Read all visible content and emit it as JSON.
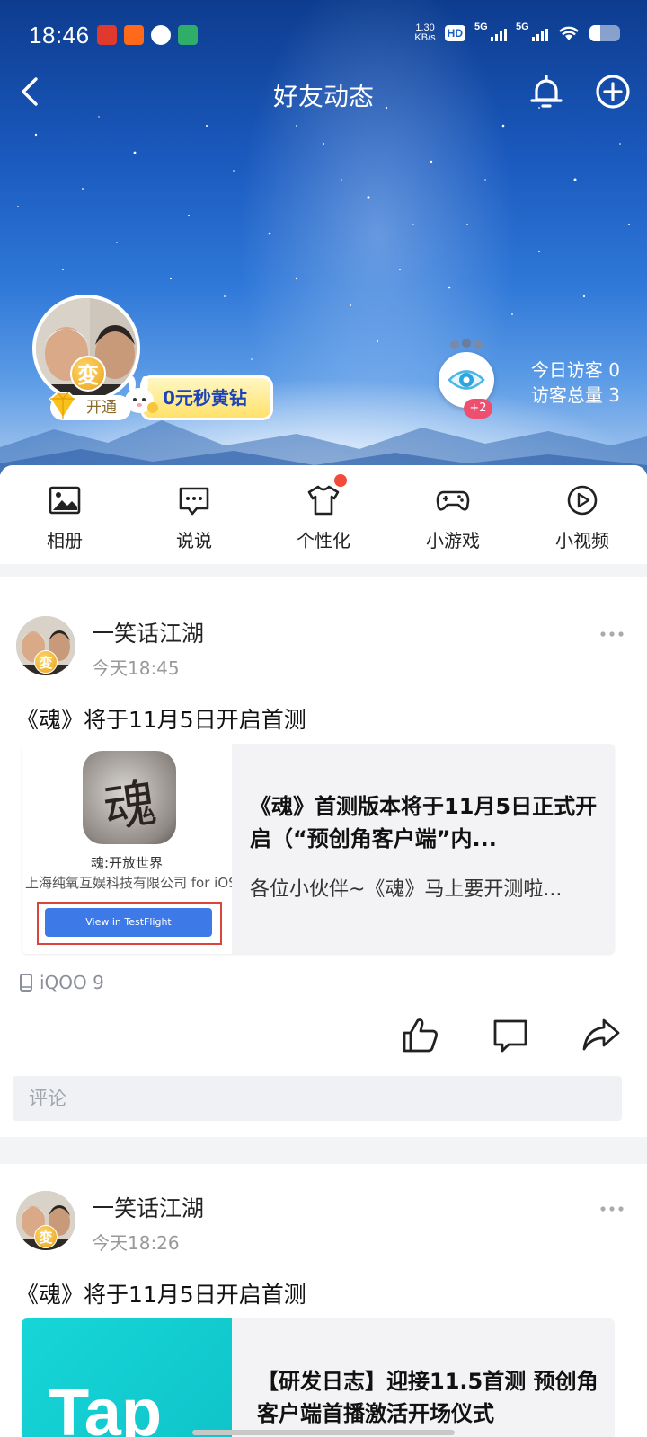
{
  "status_bar": {
    "time": "18:46",
    "net_speed_value": "1.30",
    "net_speed_unit": "KB/s",
    "hd_label": "HD",
    "signal1_label": "5G",
    "signal2_label": "5G",
    "battery_level": 0.35
  },
  "header": {
    "title": "好友动态"
  },
  "profile": {
    "badge_text": "変",
    "vip_label": "开通",
    "promo_label": "0元秒黄钻",
    "visitor_plus": "+2",
    "visitors_today": "今日访客 0",
    "visitors_total": "访客总量 3"
  },
  "function_bar": {
    "items": [
      {
        "label": "相册",
        "icon": "album-icon"
      },
      {
        "label": "说说",
        "icon": "chat-bubble-icon"
      },
      {
        "label": "个性化",
        "icon": "tshirt-icon"
      },
      {
        "label": "小游戏",
        "icon": "gamepad-icon"
      },
      {
        "label": "小视频",
        "icon": "play-circle-icon"
      }
    ]
  },
  "posts": [
    {
      "author": "一笑话江湖",
      "badge": "変",
      "time": "今天18:45",
      "text": "《魂》将于11月5日开启首测",
      "card": {
        "thumb_glyph": "魂",
        "thumb_app_title": "魂:开放世界",
        "thumb_app_company": "上海纯氧互娱科技有限公司 for iOS",
        "thumb_button": "View in TestFlight",
        "title": "《魂》首测版本将于11月5日正式开启（“预创角客户端”内...",
        "desc": "各位小伙伴~《魂》马上要开测啦..."
      },
      "device": "iQOO 9",
      "comment_placeholder": "评论"
    },
    {
      "author": "一笑话江湖",
      "badge": "変",
      "time": "今天18:26",
      "text": "《魂》将于11月5日开启首测",
      "card": {
        "thumb_text": "Tap",
        "title": "【研发日志】迎接11.5首测 预创角客户端首播激活开场仪式"
      }
    }
  ],
  "colors": {
    "accent_blue": "#1c44b8",
    "red_dot": "#f04b3b",
    "visitor_badge": "#ef4f6e",
    "testflight_blue": "#3d7ae8"
  }
}
